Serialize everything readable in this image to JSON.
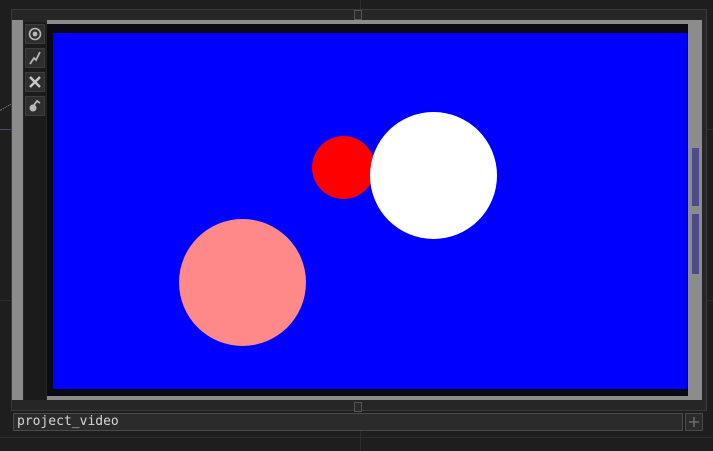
{
  "node": {
    "name": "project_video"
  },
  "toolbar": {
    "buttons": [
      {
        "icon": "viewer-toggle-icon"
      },
      {
        "icon": "bypass-icon"
      },
      {
        "icon": "close-icon"
      },
      {
        "icon": "lock-icon"
      }
    ]
  },
  "viewer": {
    "background": "#0000ff",
    "shapes": [
      {
        "name": "red-circle",
        "color": "#ff0000"
      },
      {
        "name": "white-circle",
        "color": "#ffffff"
      },
      {
        "name": "pink-circle",
        "color": "#ff8888"
      }
    ]
  },
  "colors": {
    "scrollbar": "#4e4a8c",
    "frame": "#8c8c8c"
  }
}
